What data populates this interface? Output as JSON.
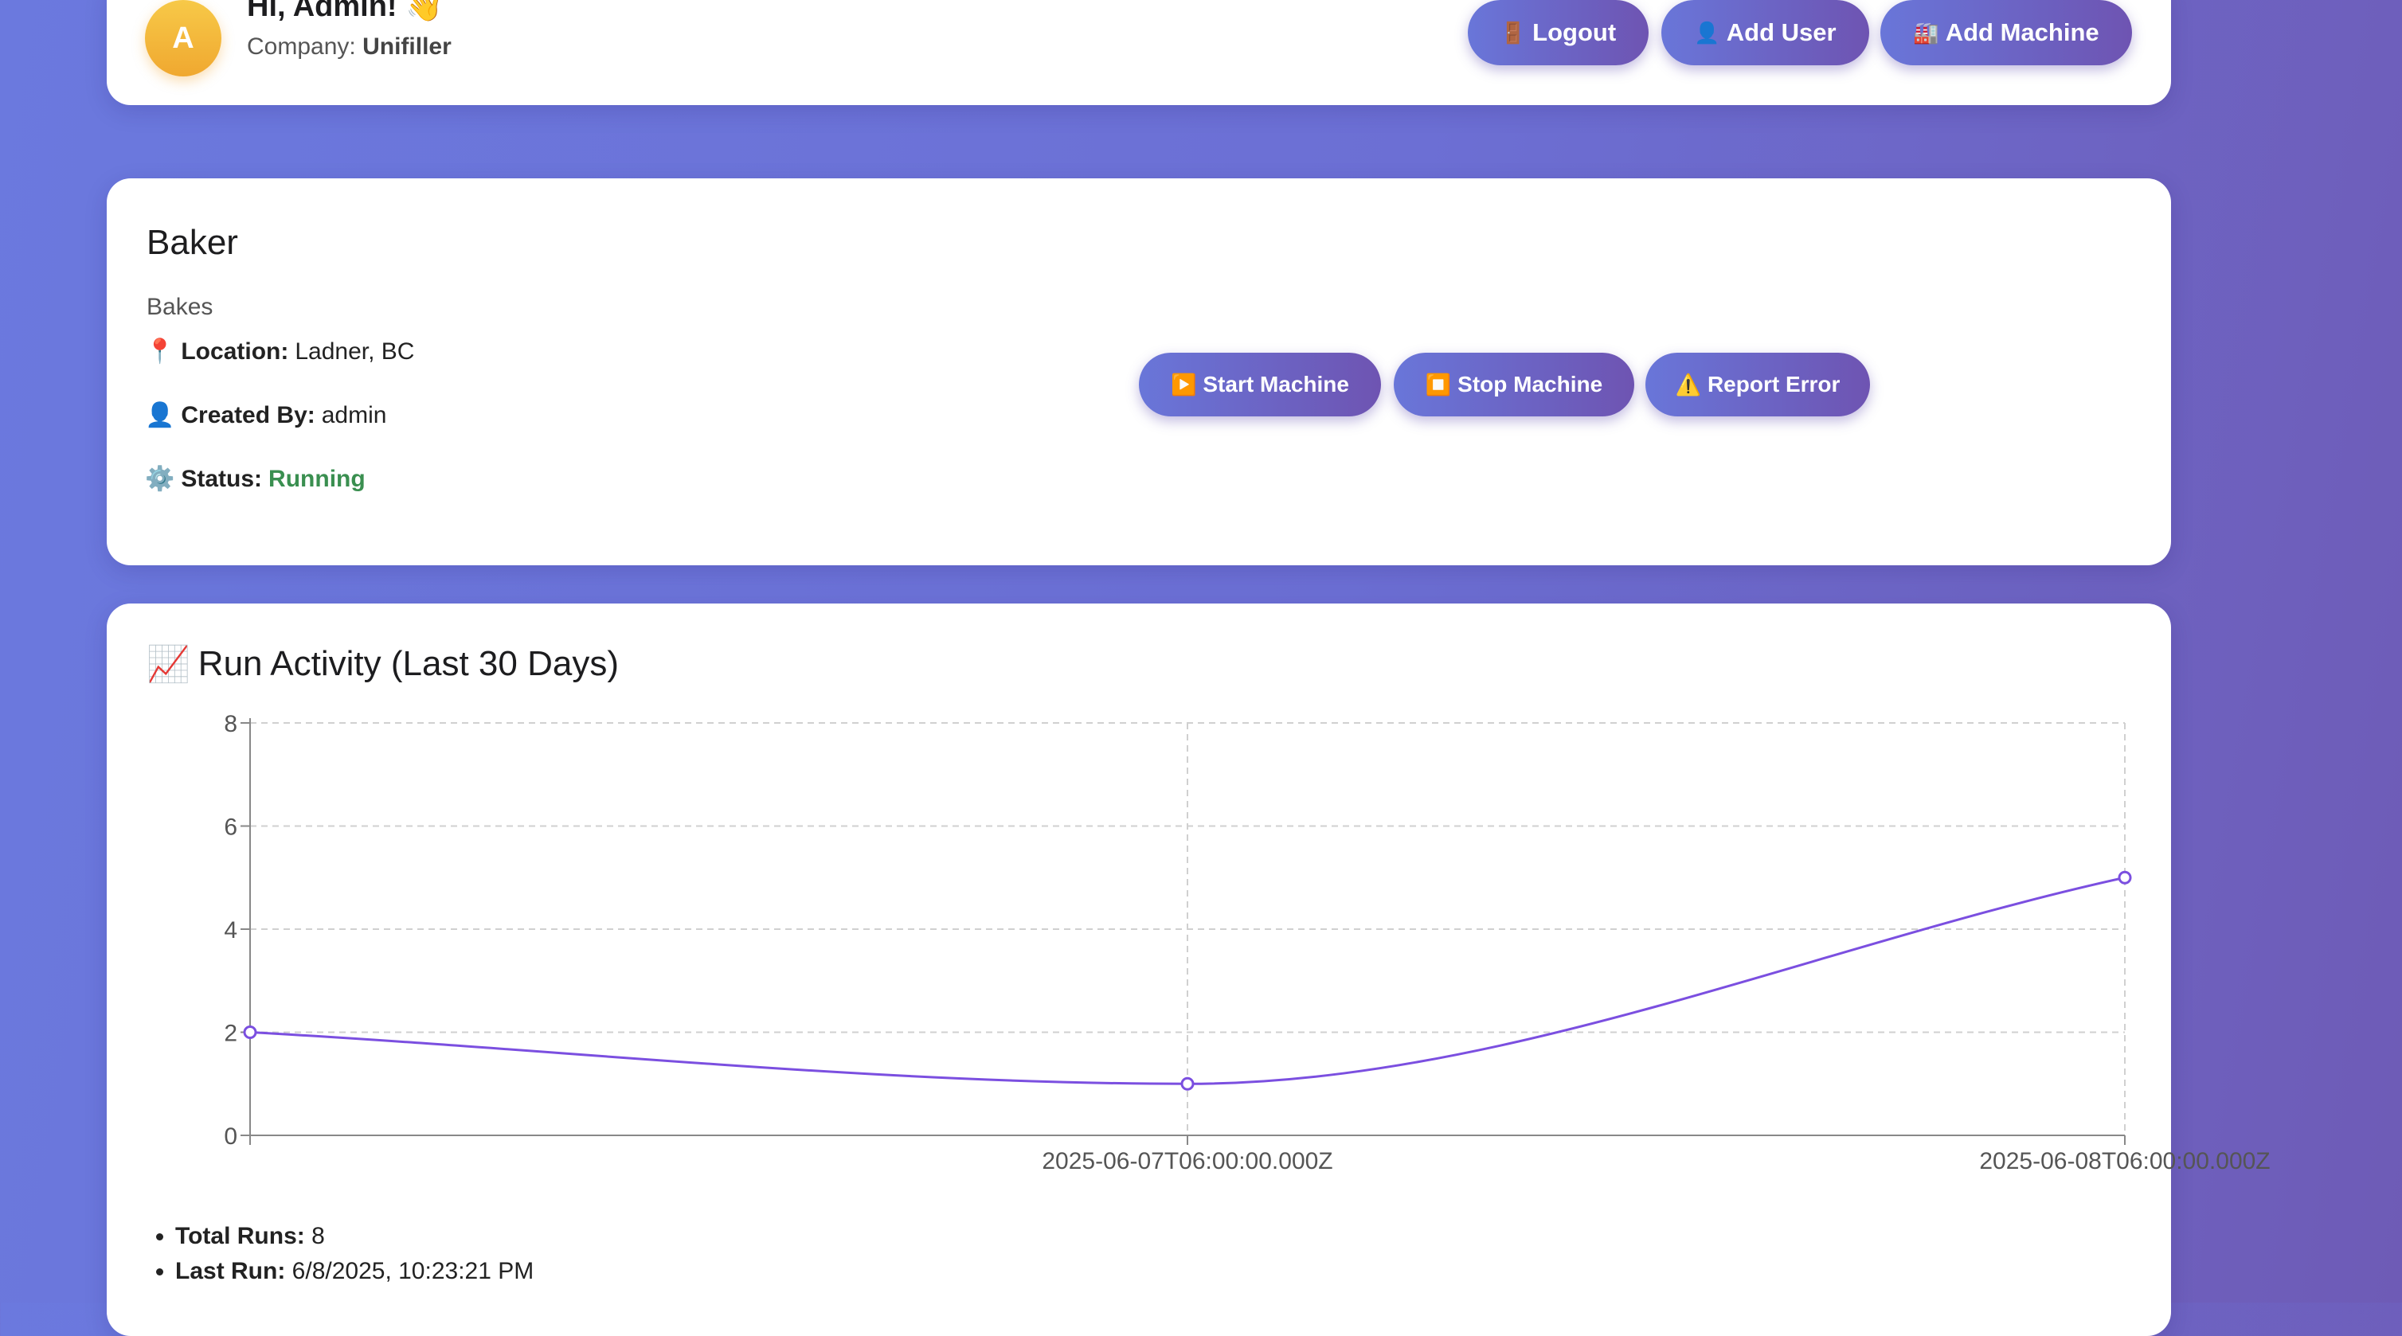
{
  "header": {
    "avatar_letter": "A",
    "greeting": "Hi, Admin! 👋",
    "company_label": "Company:",
    "company_name": "Unifiller",
    "buttons": {
      "logout": {
        "icon": "🚪",
        "label": "Logout"
      },
      "add_user": {
        "icon": "👤",
        "label": "Add User"
      },
      "add_machine": {
        "icon": "🏭",
        "label": "Add Machine"
      }
    }
  },
  "machine": {
    "name": "Baker",
    "description": "Bakes",
    "location": {
      "icon": "📍",
      "label": "Location:",
      "value": "Ladner, BC"
    },
    "created_by": {
      "icon": "👤",
      "label": "Created By:",
      "value": "admin"
    },
    "status": {
      "icon": "⚙️",
      "label": "Status:",
      "value": "Running",
      "color": "#3a8f50"
    },
    "actions": {
      "start": {
        "icon": "▶️",
        "label": "Start Machine"
      },
      "stop": {
        "icon": "⏹️",
        "label": "Stop Machine"
      },
      "report": {
        "icon": "⚠️",
        "label": "Report Error"
      }
    }
  },
  "activity": {
    "icon": "📈",
    "title": "Run Activity (Last 30 Days)",
    "total_runs_label": "Total Runs:",
    "total_runs_value": "8",
    "last_run_label": "Last Run:",
    "last_run_value": "6/8/2025, 10:23:21 PM"
  },
  "chart_data": {
    "type": "line",
    "x": [
      "",
      "2025-06-07T06:00:00.000Z",
      "2025-06-08T06:00:00.000Z"
    ],
    "values": [
      2,
      1,
      5
    ],
    "ylim": [
      0,
      8
    ],
    "yticks": [
      0,
      2,
      4,
      6,
      8
    ],
    "grid": true,
    "line_color": "#7b4fe0",
    "smooth": true
  }
}
